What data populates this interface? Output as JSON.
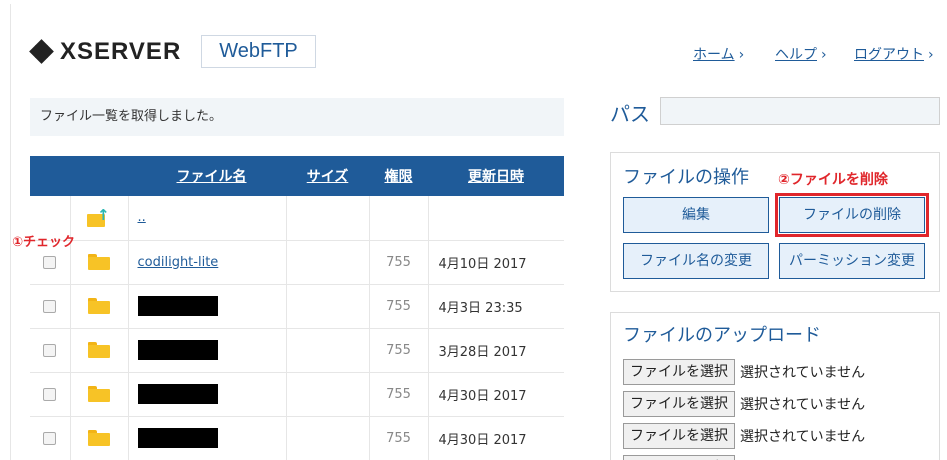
{
  "header": {
    "logo_text": "XSERVER",
    "product_label": "WebFTP",
    "nav": {
      "home": "ホーム",
      "help": "ヘルプ",
      "logout": "ログアウト"
    }
  },
  "message": "ファイル一覧を取得しました。",
  "table": {
    "headers": {
      "name": "ファイル名",
      "size": "サイズ",
      "permission": "権限",
      "updated": "更新日時"
    },
    "parent_row_label": "..",
    "rows": [
      {
        "name": "codilight-lite",
        "permission": "755",
        "updated": "4月10日 2017",
        "redacted": false
      },
      {
        "name": "",
        "permission": "755",
        "updated": "4月3日 23:35",
        "redacted": true
      },
      {
        "name": "",
        "permission": "755",
        "updated": "3月28日 2017",
        "redacted": true
      },
      {
        "name": "",
        "permission": "755",
        "updated": "4月30日 2017",
        "redacted": true
      },
      {
        "name": "",
        "permission": "755",
        "updated": "4月30日 2017",
        "redacted": true
      }
    ]
  },
  "annotations": {
    "check": "①チェック",
    "delete": "②ファイルを削除"
  },
  "path": {
    "label": "パス",
    "value": ""
  },
  "operations": {
    "title": "ファイルの操作",
    "edit": "編集",
    "delete": "ファイルの削除",
    "rename": "ファイル名の変更",
    "permission": "パーミッション変更"
  },
  "upload": {
    "title": "ファイルのアップロード",
    "choose_label": "ファイルを選択",
    "status": "選択されていません"
  },
  "colors": {
    "brand_blue": "#1f5b99",
    "annotation_red": "#e0262b",
    "folder_yellow": "#f7c326"
  }
}
